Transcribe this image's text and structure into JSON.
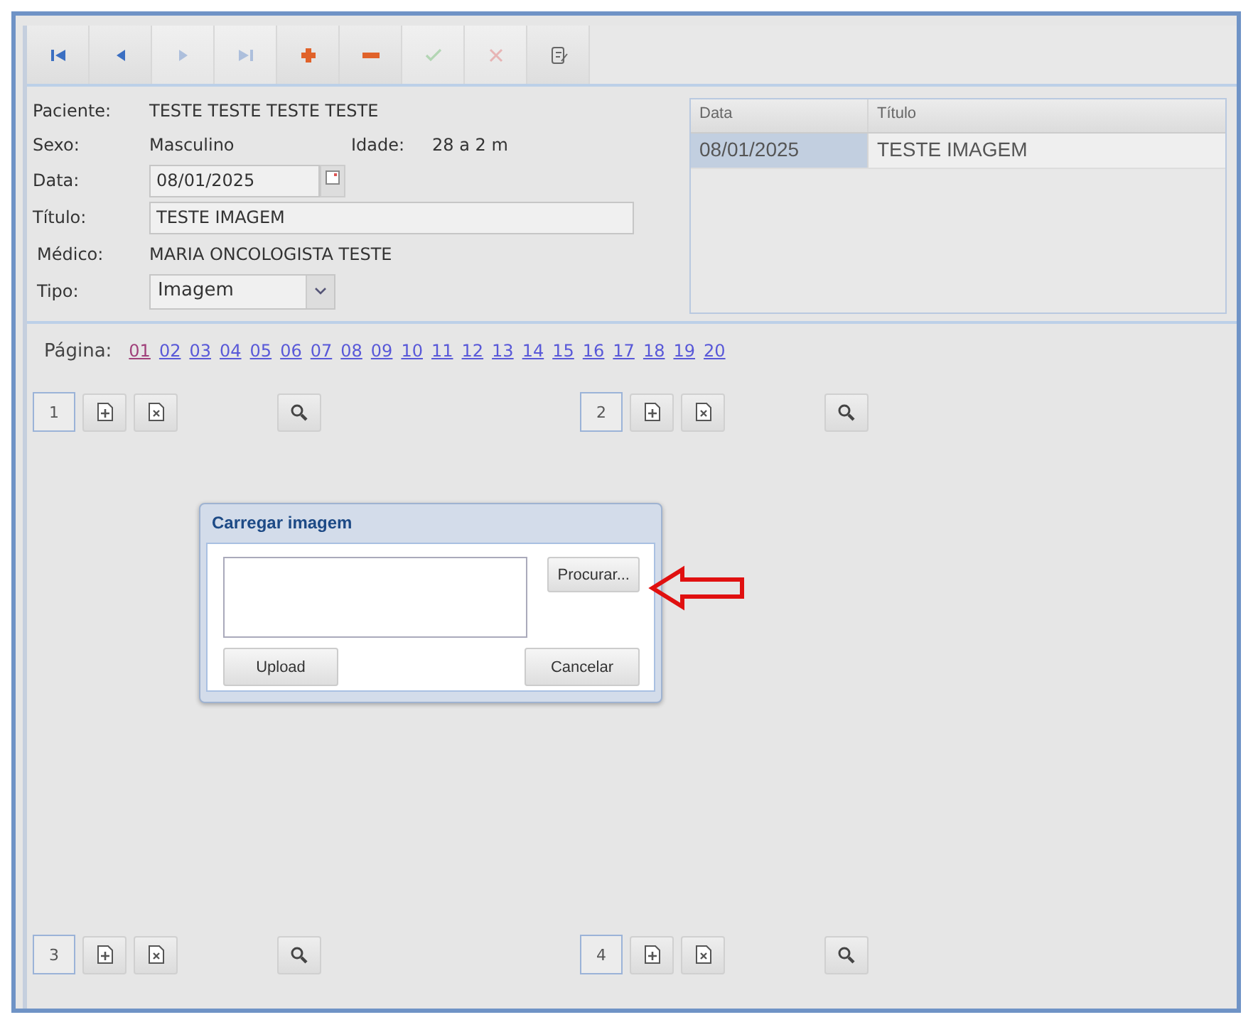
{
  "toolbar": [
    {
      "kind": "first",
      "disabled": false
    },
    {
      "kind": "prev",
      "disabled": false
    },
    {
      "kind": "next",
      "disabled": true
    },
    {
      "kind": "last",
      "disabled": true
    },
    {
      "kind": "add",
      "disabled": false
    },
    {
      "kind": "remove",
      "disabled": false
    },
    {
      "kind": "confirm",
      "disabled": true
    },
    {
      "kind": "cancel",
      "disabled": true
    },
    {
      "kind": "edit",
      "disabled": false
    }
  ],
  "form": {
    "patient_label": "Paciente:",
    "patient": "TESTE TESTE TESTE TESTE",
    "sex_label": "Sexo:",
    "sex": "Masculino",
    "age_label": "Idade:",
    "age": "28 a 2 m",
    "date_label": "Data:",
    "date": "08/01/2025",
    "title_label": "Título:",
    "title": "TESTE IMAGEM",
    "doctor_label": "Médico:",
    "doctor": "MARIA ONCOLOGISTA TESTE",
    "type_label": "Tipo:",
    "type": "Imagem"
  },
  "table": {
    "columns": [
      "Data",
      "Título"
    ],
    "rows": [
      {
        "cells": [
          "08/01/2025",
          "TESTE IMAGEM"
        ],
        "selected": true
      }
    ]
  },
  "pagination": {
    "label": "Página:",
    "pages": [
      {
        "label": "01",
        "selected": true
      },
      {
        "label": "02",
        "selected": false
      },
      {
        "label": "03",
        "selected": false
      },
      {
        "label": "04",
        "selected": false
      },
      {
        "label": "05",
        "selected": false
      },
      {
        "label": "06",
        "selected": false
      },
      {
        "label": "07",
        "selected": false
      },
      {
        "label": "08",
        "selected": false
      },
      {
        "label": "09",
        "selected": false
      },
      {
        "label": "10",
        "selected": false
      },
      {
        "label": "11",
        "selected": false
      },
      {
        "label": "12",
        "selected": false
      },
      {
        "label": "13",
        "selected": false
      },
      {
        "label": "14",
        "selected": false
      },
      {
        "label": "15",
        "selected": false
      },
      {
        "label": "16",
        "selected": false
      },
      {
        "label": "17",
        "selected": false
      },
      {
        "label": "18",
        "selected": false
      },
      {
        "label": "19",
        "selected": false
      },
      {
        "label": "20",
        "selected": false
      }
    ]
  },
  "slots": [
    {
      "number": "1"
    },
    {
      "number": "2"
    },
    {
      "number": "3"
    },
    {
      "number": "4"
    }
  ],
  "dialog": {
    "title": "Carregar imagem",
    "browse": "Procurar...",
    "upload": "Upload",
    "cancel": "Cancelar"
  }
}
